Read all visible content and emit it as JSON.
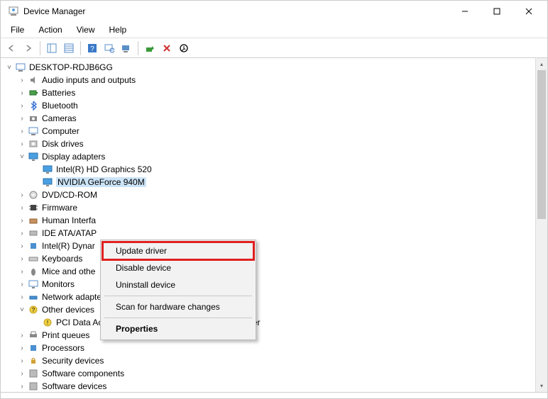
{
  "window": {
    "title": "Device Manager"
  },
  "menu": {
    "file": "File",
    "action": "Action",
    "view": "View",
    "help": "Help"
  },
  "tree": {
    "root": "DESKTOP-RDJB6GG",
    "audio": "Audio inputs and outputs",
    "batteries": "Batteries",
    "bluetooth": "Bluetooth",
    "cameras": "Cameras",
    "computer": "Computer",
    "disk": "Disk drives",
    "display": "Display adapters",
    "display_intel": "Intel(R) HD Graphics 520",
    "display_nvidia": "NVIDIA GeForce 940M",
    "dvd": "DVD/CD-ROM",
    "firmware": "Firmware",
    "hid": "Human Interfa",
    "ide": "IDE ATA/ATAP",
    "intel_dyn": "Intel(R) Dynar",
    "keyboards": "Keyboards",
    "mice": "Mice and othe",
    "monitors": "Monitors",
    "network": "Network adapters",
    "other": "Other devices",
    "other_pci": "PCI Data Acquisition and Signal Processing Controller",
    "print": "Print queues",
    "processors": "Processors",
    "security": "Security devices",
    "swcomp": "Software components",
    "swdev": "Software devices"
  },
  "context": {
    "update": "Update driver",
    "disable": "Disable device",
    "uninstall": "Uninstall device",
    "scan": "Scan for hardware changes",
    "properties": "Properties"
  }
}
